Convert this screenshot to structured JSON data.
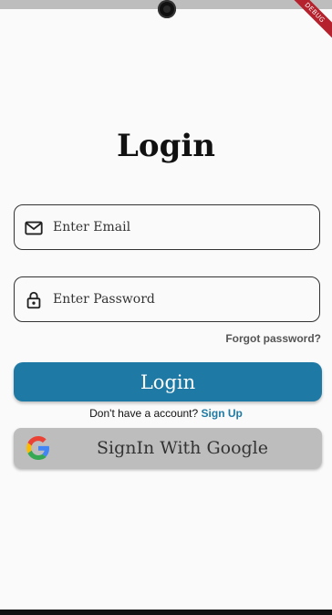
{
  "debug_banner": "DEBUG",
  "title": "Login",
  "email": {
    "placeholder": "Enter Email",
    "icon": "mail-icon"
  },
  "password": {
    "placeholder": "Enter Password",
    "icon": "lock-icon"
  },
  "forgot_password": "Forgot password?",
  "login_button": "Login",
  "signup": {
    "prompt": "Don't have a account?",
    "link": "Sign Up"
  },
  "google_button": {
    "label": "SignIn With Google",
    "icon": "google-icon"
  },
  "colors": {
    "primary": "#1e7aa5",
    "google_bg": "#bdbdbd",
    "background": "#fafafa"
  }
}
